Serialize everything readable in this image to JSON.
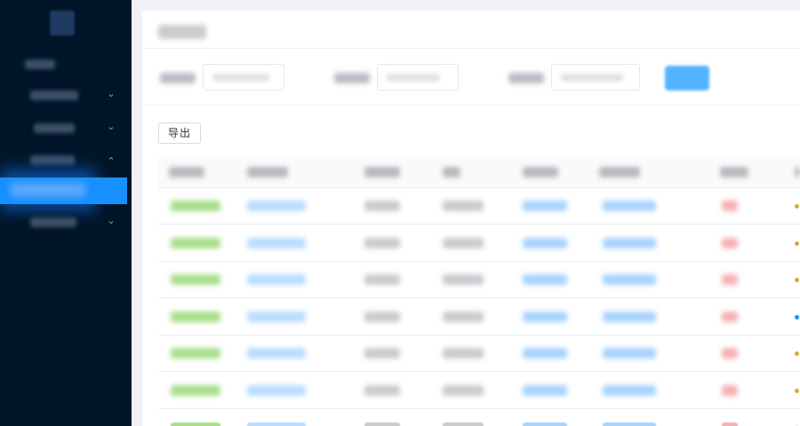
{
  "toolbar": {
    "export_label": "导出"
  },
  "sidebar": {
    "items": [
      {
        "id": "home",
        "has_chevron": false
      },
      {
        "id": "group-1",
        "has_chevron": true,
        "chevron": "down"
      },
      {
        "id": "group-2",
        "has_chevron": true,
        "chevron": "down"
      },
      {
        "id": "group-3",
        "has_chevron": true,
        "chevron": "up"
      },
      {
        "id": "active-sub",
        "active": true
      },
      {
        "id": "group-4",
        "has_chevron": true,
        "chevron": "down"
      }
    ]
  },
  "table": {
    "visible_rows": 7,
    "columns": [
      "green-link",
      "blue-link",
      "text",
      "text",
      "date",
      "date",
      "status",
      "action"
    ]
  },
  "colors": {
    "sidebar_bg": "#001529",
    "accent": "#1890ff",
    "status_red": "#f5222d",
    "link_green": "#52c41a",
    "link_blue": "#1890ff"
  }
}
